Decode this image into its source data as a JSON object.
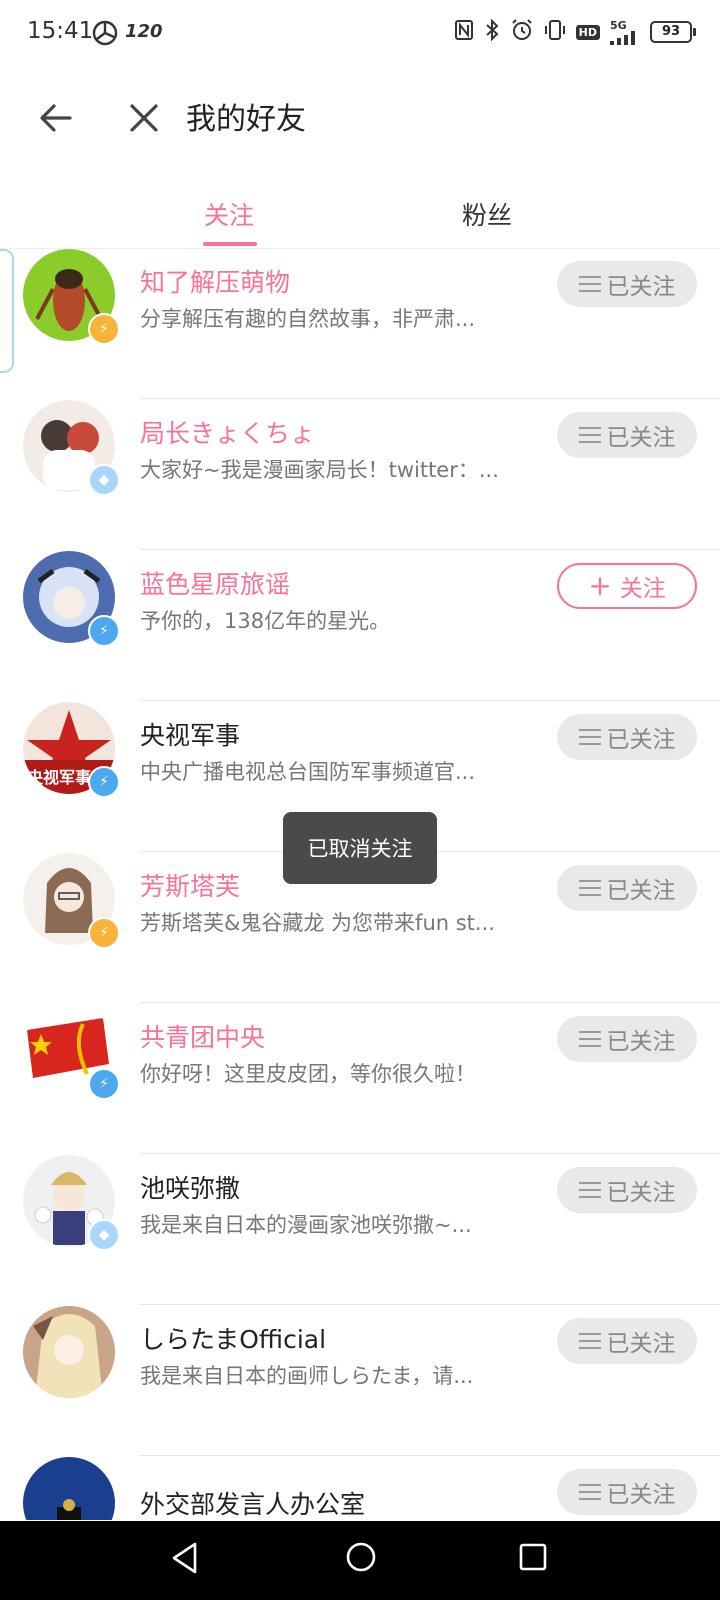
{
  "status_bar": {
    "time": "15:41",
    "refresh_rate": "120",
    "network": "5G",
    "hd": "HD",
    "battery": "93"
  },
  "header": {
    "title": "我的好友"
  },
  "tabs": [
    {
      "label": "关注",
      "active": true
    },
    {
      "label": "粉丝",
      "active": false
    }
  ],
  "follow_list": [
    {
      "name": "知了解压萌物",
      "desc": "分享解压有趣的自然故事，非严肃...",
      "name_color": "pink",
      "badge": "gold",
      "button": "已关注",
      "followed": true
    },
    {
      "name": "局长きょくちょ",
      "desc": "大家好~我是漫画家局长！twitter：...",
      "name_color": "pink",
      "badge": "diamond",
      "button": "已关注",
      "followed": true
    },
    {
      "name": "蓝色星原旅谣",
      "desc": "予你的，138亿年的星光。",
      "name_color": "pink",
      "badge": "blue",
      "button": "关注",
      "followed": false
    },
    {
      "name": "央视军事",
      "desc": "中央广播电视总台国防军事频道官...",
      "name_color": "black",
      "badge": "blue",
      "button": "已关注",
      "followed": true,
      "avatar_text": "央视军事"
    },
    {
      "name": "芳斯塔芙",
      "desc": "芳斯塔芙&鬼谷藏龙 为您带来fun st...",
      "name_color": "pink",
      "badge": "gold",
      "button": "已关注",
      "followed": true
    },
    {
      "name": "共青团中央",
      "desc": "你好呀！这里皮皮团，等你很久啦！",
      "name_color": "pink",
      "badge": "blue",
      "button": "已关注",
      "followed": true
    },
    {
      "name": "池咲弥撒",
      "desc": "我是来自日本的漫画家池咲弥撒~...",
      "name_color": "black",
      "badge": "diamond",
      "button": "已关注",
      "followed": true
    },
    {
      "name": "しらたまOfficial",
      "desc": "我是来自日本的画师しらたま，请...",
      "name_color": "black",
      "badge": "none",
      "button": "已关注",
      "followed": true
    },
    {
      "name": "外交部发言人办公室",
      "desc": "",
      "name_color": "black",
      "badge": "blue",
      "button": "已关注",
      "followed": true
    }
  ],
  "toast": "已取消关注",
  "colors": {
    "accent": "#fb7299",
    "followed_bg": "#e9e9e9"
  }
}
